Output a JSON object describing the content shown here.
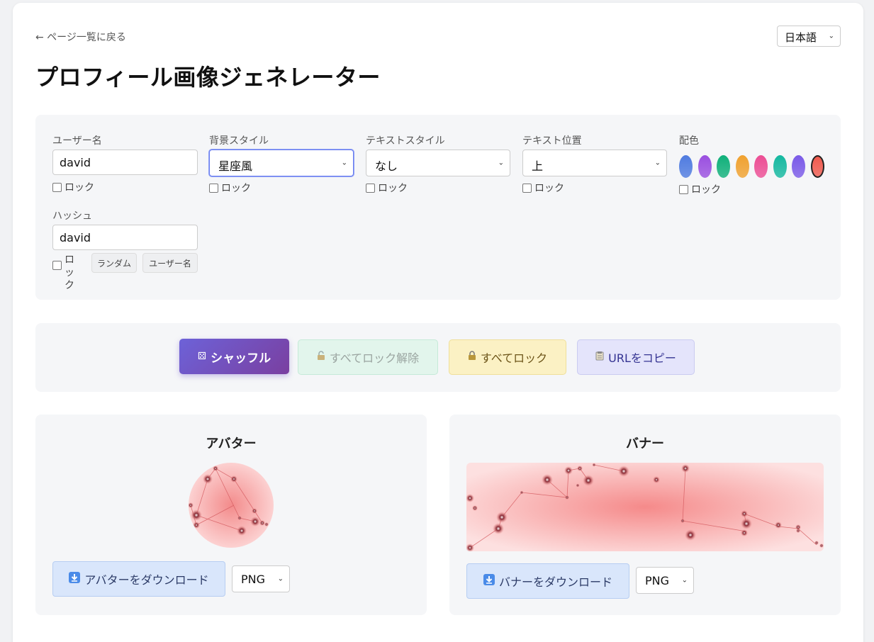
{
  "nav": {
    "back_label": "← ページ一覧に戻る",
    "language": "日本語"
  },
  "page": {
    "title": "プロフィール画像ジェネレーター"
  },
  "settings": {
    "username": {
      "label": "ユーザー名",
      "value": "david",
      "lock": "ロック"
    },
    "bg_style": {
      "label": "背景スタイル",
      "value": "星座風",
      "lock": "ロック"
    },
    "text_style": {
      "label": "テキストスタイル",
      "value": "なし",
      "lock": "ロック"
    },
    "text_position": {
      "label": "テキスト位置",
      "value": "上",
      "lock": "ロック"
    },
    "palette": {
      "label": "配色",
      "lock": "ロック",
      "colors": [
        "#4f7be0",
        "#9a4fe0",
        "#10b07a",
        "#f0a12f",
        "#ec4d94",
        "#14b8a0",
        "#7a5ae8",
        "#ef5a4e"
      ],
      "selected_index": 7
    },
    "hash": {
      "label": "ハッシュ",
      "value": "david",
      "lock": "ロック",
      "random_btn": "ランダム",
      "username_btn": "ユーザー名"
    }
  },
  "actions": {
    "shuffle": {
      "icon": "dice-icon",
      "label": "シャッフル"
    },
    "unlock_all": {
      "icon": "unlock-icon",
      "label": "すべてロック解除"
    },
    "lock_all": {
      "icon": "lock-icon",
      "label": "すべてロック"
    },
    "copy_url": {
      "icon": "clipboard-icon",
      "label": "URLをコピー"
    }
  },
  "avatar": {
    "title": "アバター",
    "download_label": "アバターをダウンロード",
    "format": "PNG"
  },
  "banner": {
    "title": "バナー",
    "download_label": "バナーをダウンロード",
    "format": "PNG"
  }
}
